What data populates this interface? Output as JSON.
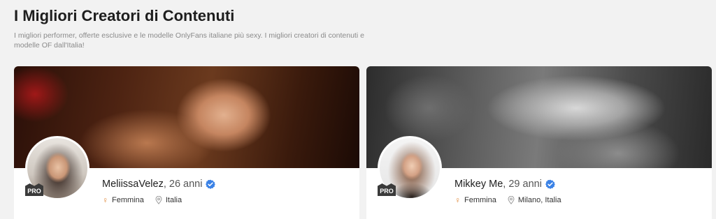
{
  "header": {
    "title": "I Migliori Creatori di Contenuti",
    "subtitle": "I migliori performer, offerte esclusive e le modelle OnlyFans italiane più sexy. I migliori creatori di contenuti e modelle OF dall'Italia!"
  },
  "creators": [
    {
      "name": "MeliissaVelez",
      "age": ", 26 anni",
      "badge": "PRO",
      "gender": "Femmina",
      "location": "Italia"
    },
    {
      "name": "Mikkey Me",
      "age": ", 29 anni",
      "badge": "PRO",
      "gender": "Femmina",
      "location": "Milano, Italia"
    }
  ],
  "colors": {
    "verified": "#3b82e6",
    "gender_icon": "#e08a3c",
    "badge_bg": "#3a3a3a"
  }
}
